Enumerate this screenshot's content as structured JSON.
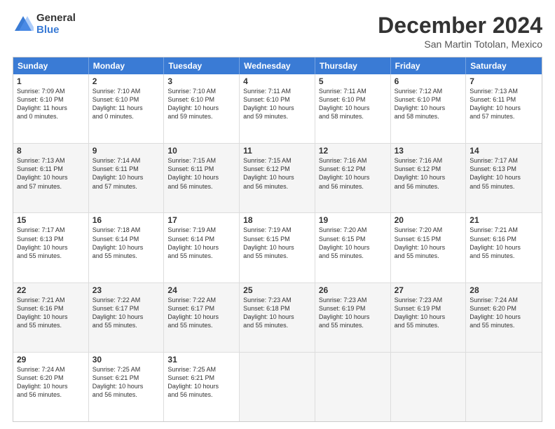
{
  "logo": {
    "general": "General",
    "blue": "Blue"
  },
  "header": {
    "month": "December 2024",
    "location": "San Martin Totolan, Mexico"
  },
  "days": [
    "Sunday",
    "Monday",
    "Tuesday",
    "Wednesday",
    "Thursday",
    "Friday",
    "Saturday"
  ],
  "weeks": [
    [
      {
        "day": "1",
        "lines": [
          "Sunrise: 7:09 AM",
          "Sunset: 6:10 PM",
          "Daylight: 11 hours",
          "and 0 minutes."
        ]
      },
      {
        "day": "2",
        "lines": [
          "Sunrise: 7:10 AM",
          "Sunset: 6:10 PM",
          "Daylight: 11 hours",
          "and 0 minutes."
        ]
      },
      {
        "day": "3",
        "lines": [
          "Sunrise: 7:10 AM",
          "Sunset: 6:10 PM",
          "Daylight: 10 hours",
          "and 59 minutes."
        ]
      },
      {
        "day": "4",
        "lines": [
          "Sunrise: 7:11 AM",
          "Sunset: 6:10 PM",
          "Daylight: 10 hours",
          "and 59 minutes."
        ]
      },
      {
        "day": "5",
        "lines": [
          "Sunrise: 7:11 AM",
          "Sunset: 6:10 PM",
          "Daylight: 10 hours",
          "and 58 minutes."
        ]
      },
      {
        "day": "6",
        "lines": [
          "Sunrise: 7:12 AM",
          "Sunset: 6:10 PM",
          "Daylight: 10 hours",
          "and 58 minutes."
        ]
      },
      {
        "day": "7",
        "lines": [
          "Sunrise: 7:13 AM",
          "Sunset: 6:11 PM",
          "Daylight: 10 hours",
          "and 57 minutes."
        ]
      }
    ],
    [
      {
        "day": "8",
        "lines": [
          "Sunrise: 7:13 AM",
          "Sunset: 6:11 PM",
          "Daylight: 10 hours",
          "and 57 minutes."
        ]
      },
      {
        "day": "9",
        "lines": [
          "Sunrise: 7:14 AM",
          "Sunset: 6:11 PM",
          "Daylight: 10 hours",
          "and 57 minutes."
        ]
      },
      {
        "day": "10",
        "lines": [
          "Sunrise: 7:15 AM",
          "Sunset: 6:11 PM",
          "Daylight: 10 hours",
          "and 56 minutes."
        ]
      },
      {
        "day": "11",
        "lines": [
          "Sunrise: 7:15 AM",
          "Sunset: 6:12 PM",
          "Daylight: 10 hours",
          "and 56 minutes."
        ]
      },
      {
        "day": "12",
        "lines": [
          "Sunrise: 7:16 AM",
          "Sunset: 6:12 PM",
          "Daylight: 10 hours",
          "and 56 minutes."
        ]
      },
      {
        "day": "13",
        "lines": [
          "Sunrise: 7:16 AM",
          "Sunset: 6:12 PM",
          "Daylight: 10 hours",
          "and 56 minutes."
        ]
      },
      {
        "day": "14",
        "lines": [
          "Sunrise: 7:17 AM",
          "Sunset: 6:13 PM",
          "Daylight: 10 hours",
          "and 55 minutes."
        ]
      }
    ],
    [
      {
        "day": "15",
        "lines": [
          "Sunrise: 7:17 AM",
          "Sunset: 6:13 PM",
          "Daylight: 10 hours",
          "and 55 minutes."
        ]
      },
      {
        "day": "16",
        "lines": [
          "Sunrise: 7:18 AM",
          "Sunset: 6:14 PM",
          "Daylight: 10 hours",
          "and 55 minutes."
        ]
      },
      {
        "day": "17",
        "lines": [
          "Sunrise: 7:19 AM",
          "Sunset: 6:14 PM",
          "Daylight: 10 hours",
          "and 55 minutes."
        ]
      },
      {
        "day": "18",
        "lines": [
          "Sunrise: 7:19 AM",
          "Sunset: 6:15 PM",
          "Daylight: 10 hours",
          "and 55 minutes."
        ]
      },
      {
        "day": "19",
        "lines": [
          "Sunrise: 7:20 AM",
          "Sunset: 6:15 PM",
          "Daylight: 10 hours",
          "and 55 minutes."
        ]
      },
      {
        "day": "20",
        "lines": [
          "Sunrise: 7:20 AM",
          "Sunset: 6:15 PM",
          "Daylight: 10 hours",
          "and 55 minutes."
        ]
      },
      {
        "day": "21",
        "lines": [
          "Sunrise: 7:21 AM",
          "Sunset: 6:16 PM",
          "Daylight: 10 hours",
          "and 55 minutes."
        ]
      }
    ],
    [
      {
        "day": "22",
        "lines": [
          "Sunrise: 7:21 AM",
          "Sunset: 6:16 PM",
          "Daylight: 10 hours",
          "and 55 minutes."
        ]
      },
      {
        "day": "23",
        "lines": [
          "Sunrise: 7:22 AM",
          "Sunset: 6:17 PM",
          "Daylight: 10 hours",
          "and 55 minutes."
        ]
      },
      {
        "day": "24",
        "lines": [
          "Sunrise: 7:22 AM",
          "Sunset: 6:17 PM",
          "Daylight: 10 hours",
          "and 55 minutes."
        ]
      },
      {
        "day": "25",
        "lines": [
          "Sunrise: 7:23 AM",
          "Sunset: 6:18 PM",
          "Daylight: 10 hours",
          "and 55 minutes."
        ]
      },
      {
        "day": "26",
        "lines": [
          "Sunrise: 7:23 AM",
          "Sunset: 6:19 PM",
          "Daylight: 10 hours",
          "and 55 minutes."
        ]
      },
      {
        "day": "27",
        "lines": [
          "Sunrise: 7:23 AM",
          "Sunset: 6:19 PM",
          "Daylight: 10 hours",
          "and 55 minutes."
        ]
      },
      {
        "day": "28",
        "lines": [
          "Sunrise: 7:24 AM",
          "Sunset: 6:20 PM",
          "Daylight: 10 hours",
          "and 55 minutes."
        ]
      }
    ],
    [
      {
        "day": "29",
        "lines": [
          "Sunrise: 7:24 AM",
          "Sunset: 6:20 PM",
          "Daylight: 10 hours",
          "and 56 minutes."
        ]
      },
      {
        "day": "30",
        "lines": [
          "Sunrise: 7:25 AM",
          "Sunset: 6:21 PM",
          "Daylight: 10 hours",
          "and 56 minutes."
        ]
      },
      {
        "day": "31",
        "lines": [
          "Sunrise: 7:25 AM",
          "Sunset: 6:21 PM",
          "Daylight: 10 hours",
          "and 56 minutes."
        ]
      },
      {
        "day": "",
        "lines": []
      },
      {
        "day": "",
        "lines": []
      },
      {
        "day": "",
        "lines": []
      },
      {
        "day": "",
        "lines": []
      }
    ]
  ]
}
